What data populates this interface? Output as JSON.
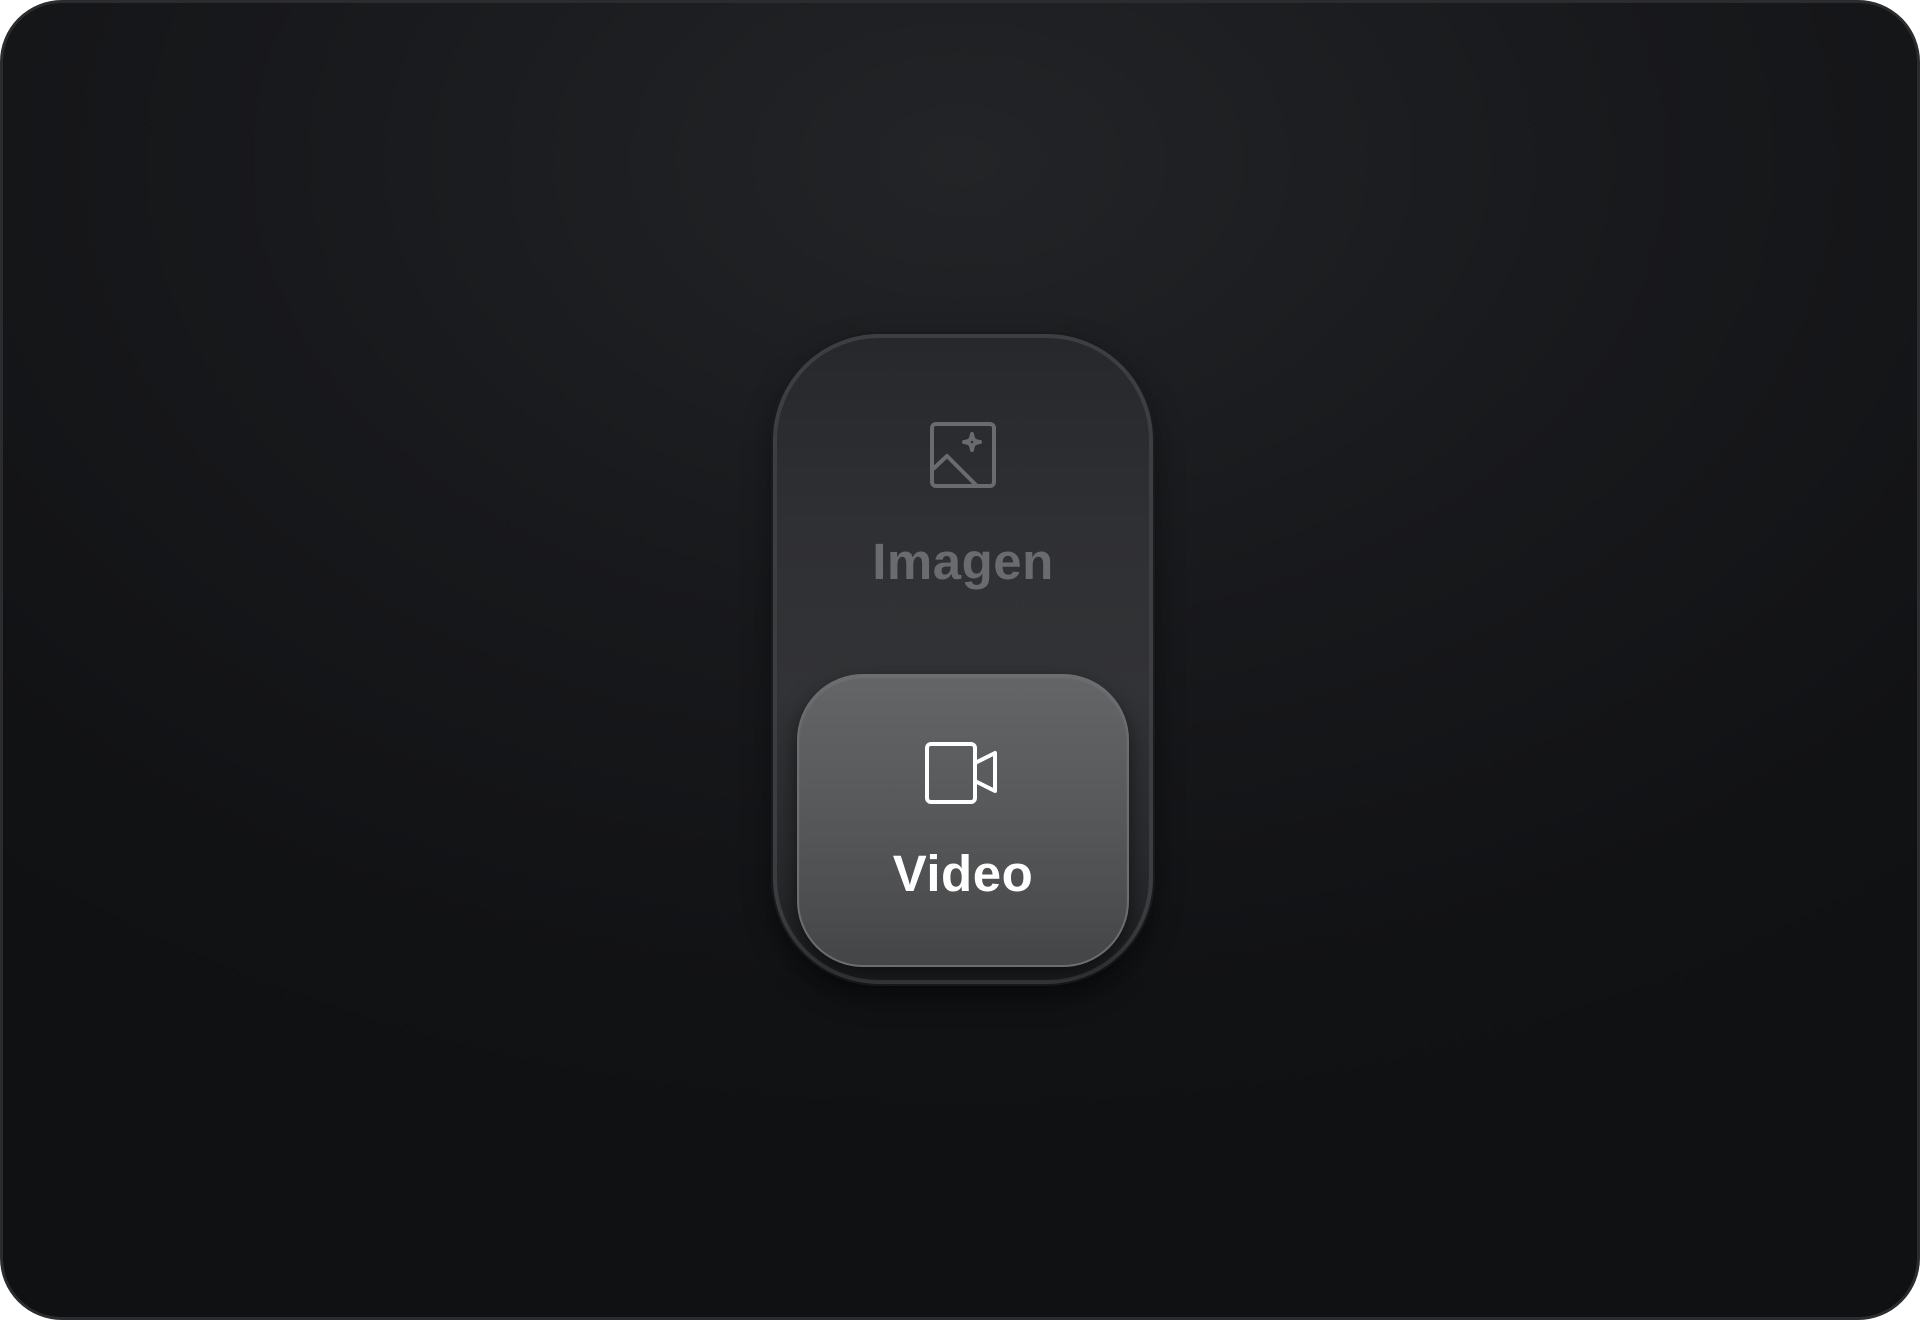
{
  "mode_switcher": {
    "options": [
      {
        "label": "Imagen",
        "icon": "image-sparkle-icon",
        "selected": false
      },
      {
        "label": "Video",
        "icon": "video-camera-icon",
        "selected": true
      }
    ]
  },
  "colors": {
    "background": "#141517",
    "switcher_track": "#2f3033",
    "selected_pill": "#58595b",
    "inactive_text": "#6a6b6e",
    "active_text": "#ffffff"
  }
}
